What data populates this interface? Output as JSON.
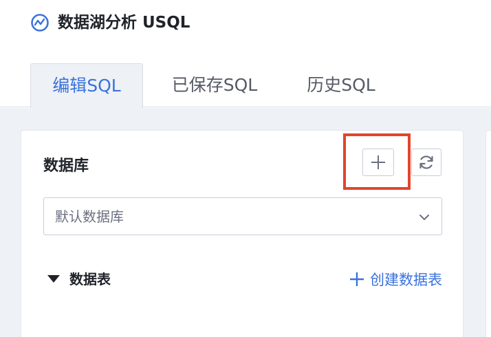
{
  "header": {
    "app_title": "数据湖分析 USQL",
    "logo_icon": "analytics-chart-icon"
  },
  "tabs": [
    {
      "label": "编辑SQL",
      "active": true
    },
    {
      "label": "已保存SQL",
      "active": false
    },
    {
      "label": "历史SQL",
      "active": false
    }
  ],
  "database_panel": {
    "title": "数据库",
    "add_icon": "plus-icon",
    "refresh_icon": "refresh-icon",
    "select": {
      "value": "默认数据库",
      "icon": "chevron-down-icon"
    },
    "tables": {
      "label": "数据表",
      "expanded": true,
      "create_label": "创建数据表"
    }
  },
  "colors": {
    "accent": "#3a72dc",
    "highlight": "#e2442c",
    "background": "#eef1f6"
  }
}
